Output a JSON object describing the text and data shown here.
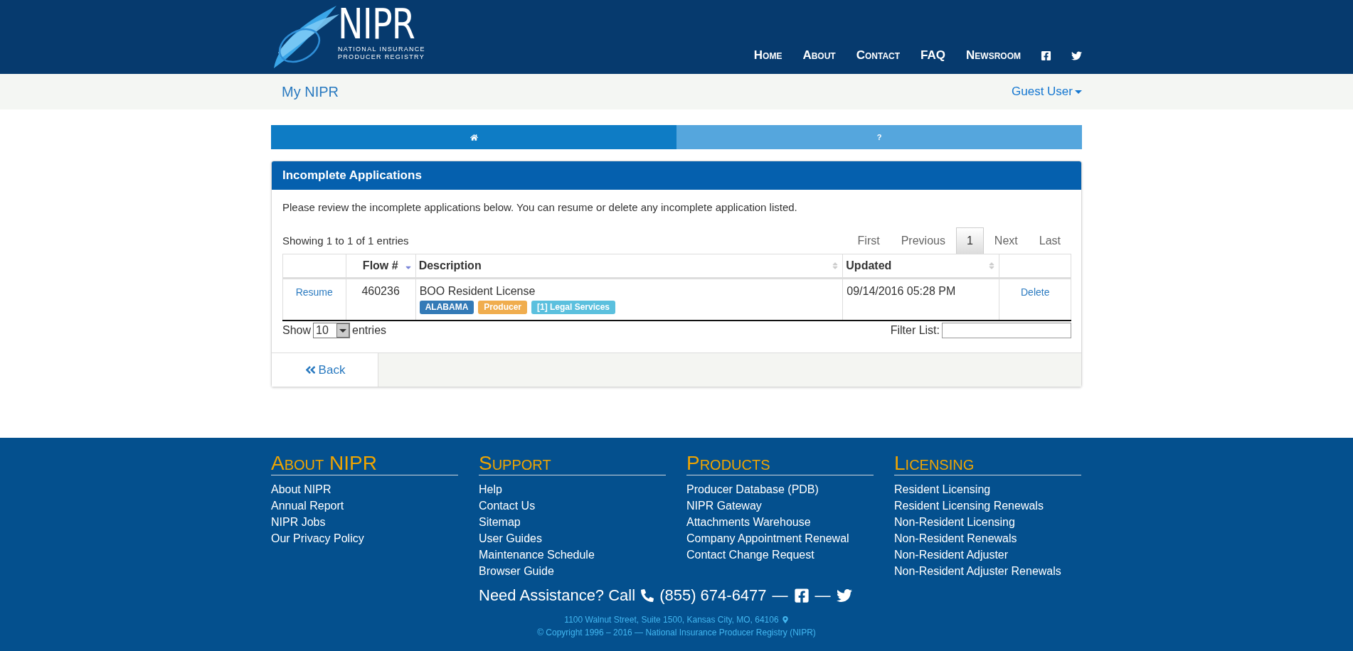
{
  "logo": {
    "name": "NIPR",
    "tagline_1": "NATIONAL INSURANCE",
    "tagline_2": "PRODUCER REGISTRY"
  },
  "nav": {
    "links": [
      "Home",
      "About",
      "Contact",
      "FAQ",
      "Newsroom"
    ],
    "social": [
      {
        "kind": "facebook"
      },
      {
        "kind": "twitter"
      }
    ]
  },
  "subbar": {
    "title": "My NIPR",
    "user": "Guest User"
  },
  "tabs": [
    {
      "kind": "home",
      "selected": true
    },
    {
      "kind": "text",
      "label": "?",
      "selected": false
    }
  ],
  "panel": {
    "title": "Incomplete Applications",
    "intro": "Please review the incomplete applications below. You can resume or delete any incomplete application listed.",
    "info": "Showing 1 to 1 of 1 entries",
    "pager": [
      {
        "label": "First",
        "selected": false
      },
      {
        "label": "Previous",
        "selected": false
      },
      {
        "label": "1",
        "selected": true
      },
      {
        "label": "Next",
        "selected": false
      },
      {
        "label": "Last",
        "selected": false
      }
    ],
    "columns": [
      {
        "kind": "plain"
      },
      {
        "label": "Flow #",
        "kind": "sorted"
      },
      {
        "label": "Description",
        "kind": "sortable"
      },
      {
        "label": "Updated",
        "kind": "sortable"
      },
      {
        "kind": "plain"
      }
    ],
    "rows": [
      {
        "resume": "Resume",
        "flow": "460236",
        "description": "BOO Resident License",
        "tags": [
          {
            "label": "ALABAMA",
            "color": "#337ab7"
          },
          {
            "label": "Producer",
            "color": "#f0ad4e"
          },
          {
            "label": "[1] Legal Services",
            "color": "#5bc0de"
          }
        ],
        "updated": "09/14/2016 05:28 PM",
        "delete": "Delete"
      }
    ],
    "show_label": "Show",
    "page_size": "10",
    "entries_label": "entries",
    "filter_label": "Filter List:",
    "back": "Back"
  },
  "footer": {
    "columns": [
      {
        "heading": "About NIPR",
        "links": [
          "About NIPR",
          "Annual Report",
          "NIPR Jobs",
          "Our Privacy Policy"
        ]
      },
      {
        "heading": "Support",
        "links": [
          "Help",
          "Contact Us",
          "Sitemap",
          "User Guides",
          "Maintenance Schedule",
          "Browser Guide"
        ]
      },
      {
        "heading": "Products",
        "links": [
          "Producer Database (PDB)",
          "NIPR Gateway",
          "Attachments Warehouse",
          "Company Appointment Renewal",
          "Contact Change Request"
        ]
      },
      {
        "heading": "Licensing",
        "links": [
          "Resident Licensing",
          "Resident Licensing Renewals",
          "Non-Resident Licensing",
          "Non-Resident Renewals",
          "Non-Resident Adjuster",
          "Non-Resident Adjuster Renewals"
        ]
      }
    ],
    "assist": "Need Assistance? Call",
    "phone": "(855) 674-6477",
    "dash_1": "—",
    "dash_2": "—",
    "address": "1100 Walnut Street, Suite 1500, Kansas City, MO, 64106",
    "copyright": "© Copyright 1996 – 2016 — National Insurance Producer Registry (NIPR)"
  }
}
